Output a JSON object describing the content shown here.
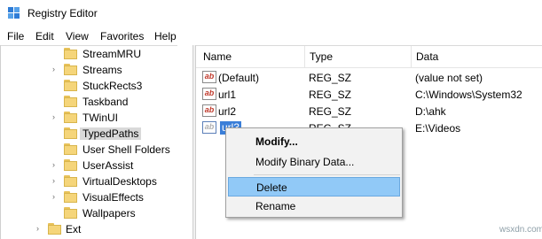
{
  "window": {
    "title": "Registry Editor",
    "icon": "registry-icon"
  },
  "menu": [
    "File",
    "Edit",
    "View",
    "Favorites",
    "Help"
  ],
  "tree": {
    "items": [
      {
        "label": "StreamMRU",
        "expandable": false,
        "selected": false
      },
      {
        "label": "Streams",
        "expandable": true,
        "selected": false
      },
      {
        "label": "StuckRects3",
        "expandable": false,
        "selected": false
      },
      {
        "label": "Taskband",
        "expandable": false,
        "selected": false
      },
      {
        "label": "TWinUI",
        "expandable": true,
        "selected": false
      },
      {
        "label": "TypedPaths",
        "expandable": false,
        "selected": true
      },
      {
        "label": "User Shell Folders",
        "expandable": false,
        "selected": false
      },
      {
        "label": "UserAssist",
        "expandable": true,
        "selected": false
      },
      {
        "label": "VirtualDesktops",
        "expandable": true,
        "selected": false
      },
      {
        "label": "VisualEffects",
        "expandable": true,
        "selected": false
      },
      {
        "label": "Wallpapers",
        "expandable": false,
        "selected": false
      },
      {
        "label": "Ext",
        "expandable": true,
        "selected": false
      }
    ]
  },
  "list": {
    "columns": [
      "Name",
      "Type",
      "Data"
    ],
    "rows": [
      {
        "name": "(Default)",
        "type": "REG_SZ",
        "data": "(value not set)",
        "icon": "string-value-icon"
      },
      {
        "name": "url1",
        "type": "REG_SZ",
        "data": "C:\\Windows\\System32",
        "icon": "string-value-icon"
      },
      {
        "name": "url2",
        "type": "REG_SZ",
        "data": "D:\\ahk",
        "icon": "string-value-icon"
      },
      {
        "name": "url3",
        "type": "REG_SZ",
        "data": "E:\\Videos",
        "icon": "string-value-icon",
        "editing": true
      }
    ]
  },
  "context_menu": {
    "items": [
      {
        "label": "Modify...",
        "bold": true
      },
      {
        "label": "Modify Binary Data..."
      },
      {
        "label": "Delete",
        "hovered": true
      },
      {
        "label": "Rename"
      }
    ]
  },
  "watermark": "wsxdn.com",
  "colors": {
    "selection": "#3a7ed8",
    "hover": "#91c9f7",
    "folder": "#f5d57a"
  }
}
